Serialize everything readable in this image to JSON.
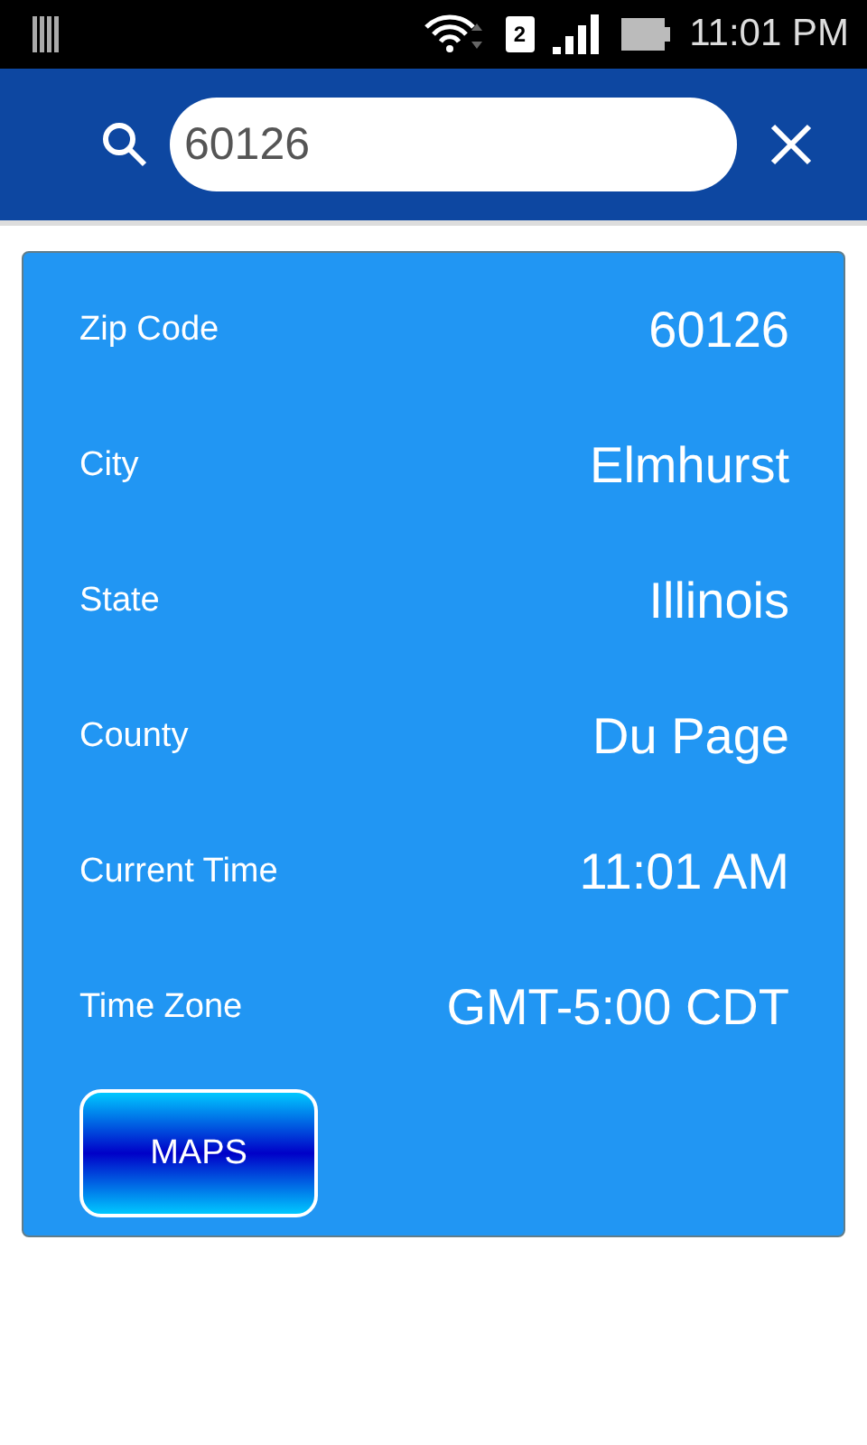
{
  "status_bar": {
    "sim": "2",
    "time": "11:01 PM"
  },
  "search": {
    "value": "60126"
  },
  "details": [
    {
      "label": "Zip Code",
      "value": "60126"
    },
    {
      "label": "City",
      "value": "Elmhurst"
    },
    {
      "label": "State",
      "value": "Illinois"
    },
    {
      "label": "County",
      "value": "Du Page"
    },
    {
      "label": "Current Time",
      "value": "11:01 AM"
    },
    {
      "label": "Time Zone",
      "value": "GMT-5:00 CDT"
    }
  ],
  "button": "MAPS"
}
